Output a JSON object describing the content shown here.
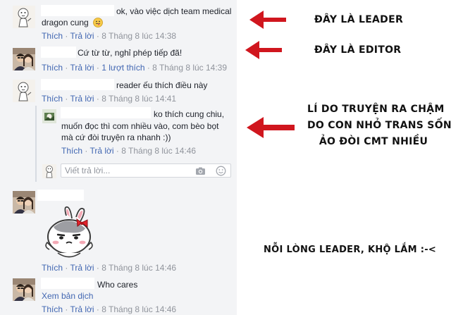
{
  "thread": {
    "c1": {
      "text_line1": "ok, vào việc dịch team medical",
      "text_line2": "dragon cung",
      "like": "Thích",
      "reply": "Trả lời",
      "time": "8 Tháng 8 lúc 14:38"
    },
    "c2": {
      "text": "Cứ từ từ, nghỉ phép tiếp đã!",
      "like": "Thích",
      "reply": "Trả lời",
      "likes": "1 lượt thích",
      "time": "8 Tháng 8 lúc 14:39"
    },
    "c3": {
      "text": "reader ếu thích điều này",
      "like": "Thích",
      "reply": "Trả lời",
      "time": "8 Tháng 8 lúc 14:41"
    },
    "c4": {
      "text_line1": "ko thích cung chiu,",
      "text_line2": "muốn đọc thì com nhiều vào, com bèo bọt",
      "text_line3": "mà cứ đòi truyện ra nhanh :))",
      "like": "Thích",
      "reply": "Trả lời",
      "time": "8 Tháng 8 lúc 14:46"
    },
    "reply_input": {
      "placeholder": "Viết trả lời..."
    },
    "c5": {
      "like": "Thích",
      "reply": "Trả lời",
      "time": "8 Tháng 8 lúc 14:46"
    },
    "c6": {
      "text": "Who cares",
      "translate": "Xem bản dịch",
      "like": "Thích",
      "reply": "Trả lời",
      "time": "8 Tháng 8 lúc 14:46"
    }
  },
  "annotations": {
    "leader": "ĐÂY LÀ LEADER",
    "editor": "ĐÂY LÀ EDITOR",
    "reason_line1": "LÍ DO TRUYỆN RA CHẬM",
    "reason_line2": "DO CON NHỎ TRANS SỐNG",
    "reason_line3": "ẢO ĐÒI CMT NHIỀU",
    "feelings": "NỖI LÒNG LEADER, KHỘ LẮM :-<"
  },
  "colors": {
    "link": "#4267b2",
    "meta": "#90949c",
    "text": "#1d2129",
    "arrow": "#d0161e",
    "panel": "#f3f4f6"
  },
  "icons": {
    "camera": "camera-icon",
    "emoji": "emoji-icon",
    "arrow": "red-arrow-icon",
    "sticker": "bunny-sticker"
  }
}
